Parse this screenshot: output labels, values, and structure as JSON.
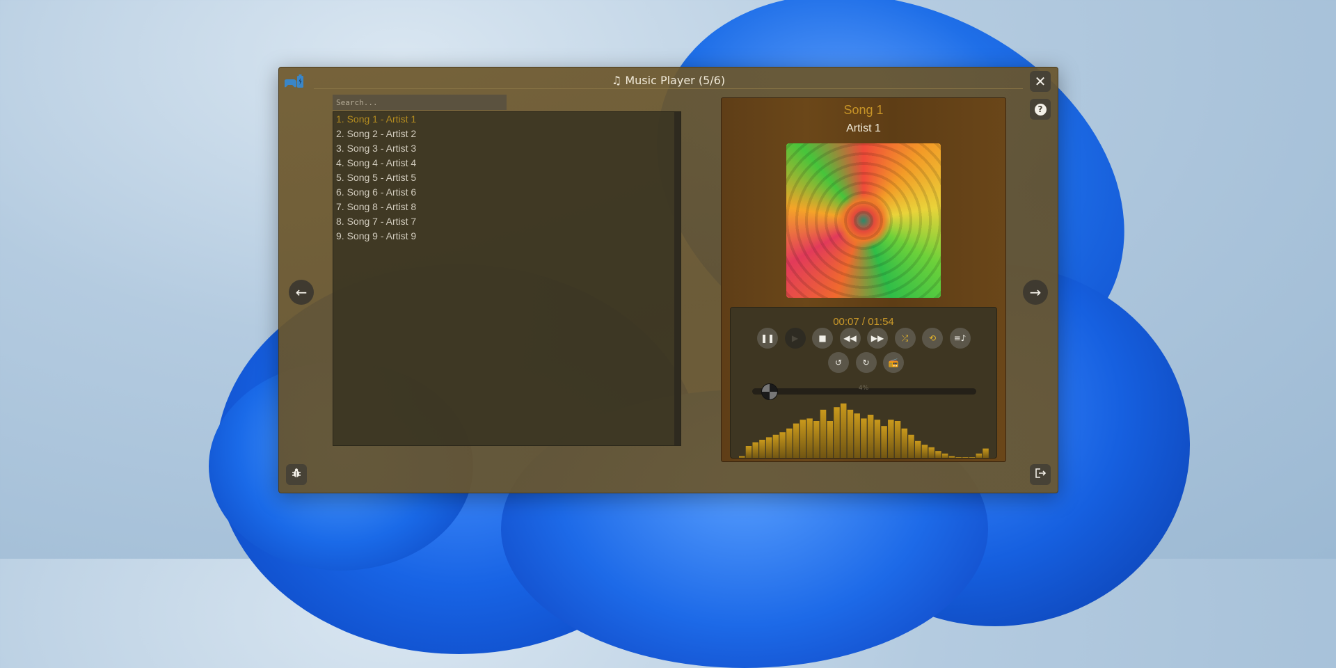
{
  "window": {
    "title": "♫ Music Player (5/6)"
  },
  "icons": {
    "app": "gamepad-battery-icon",
    "close": "close-icon",
    "help": "help-icon",
    "prev": "arrow-left-icon",
    "next": "arrow-right-icon",
    "bug": "bug-icon",
    "exit": "exit-icon"
  },
  "search": {
    "placeholder": "Search..."
  },
  "playlist": [
    "1. Song 1 - Artist 1",
    "2. Song 2 - Artist 2",
    "3. Song 3 - Artist 3",
    "4. Song 4 - Artist 4",
    "5. Song 5 - Artist 5",
    "6. Song 6 - Artist 6",
    "7. Song 8 - Artist 8",
    "8. Song 7 - Artist 7",
    "9. Song 9 - Artist 9"
  ],
  "now_playing": {
    "title": "Song 1",
    "artist": "Artist 1",
    "time": "00:07 / 01:54",
    "progress_label": "4%",
    "progress": 0.04
  },
  "controls": {
    "row1": [
      {
        "name": "pause-button",
        "icon": "pause-icon",
        "state": "normal"
      },
      {
        "name": "play-button",
        "icon": "play-icon",
        "state": "disabled"
      },
      {
        "name": "stop-button",
        "icon": "stop-icon",
        "state": "normal"
      },
      {
        "name": "rewind-button",
        "icon": "rewind-icon",
        "state": "normal"
      },
      {
        "name": "fast-forward-button",
        "icon": "fast-forward-icon",
        "state": "normal"
      },
      {
        "name": "shuffle-button",
        "icon": "shuffle-icon",
        "state": "active"
      },
      {
        "name": "repeat-button",
        "icon": "repeat-icon",
        "state": "active"
      },
      {
        "name": "playlist-button",
        "icon": "playlist-icon",
        "state": "normal"
      }
    ],
    "row2": [
      {
        "name": "replay-back-button",
        "icon": "rotate-left-icon",
        "state": "normal"
      },
      {
        "name": "replay-forward-button",
        "icon": "rotate-right-icon",
        "state": "normal"
      },
      {
        "name": "radio-button",
        "icon": "radio-icon",
        "state": "normal"
      }
    ]
  },
  "visualizer": [
    4,
    20,
    26,
    30,
    34,
    38,
    42,
    48,
    56,
    62,
    64,
    60,
    78,
    60,
    82,
    88,
    78,
    72,
    64,
    70,
    62,
    52,
    62,
    60,
    48,
    38,
    28,
    22,
    18,
    12,
    8,
    4,
    2,
    2,
    2,
    8,
    16
  ],
  "colors": {
    "accent": "#c79427",
    "bars": "#b38b1a"
  }
}
